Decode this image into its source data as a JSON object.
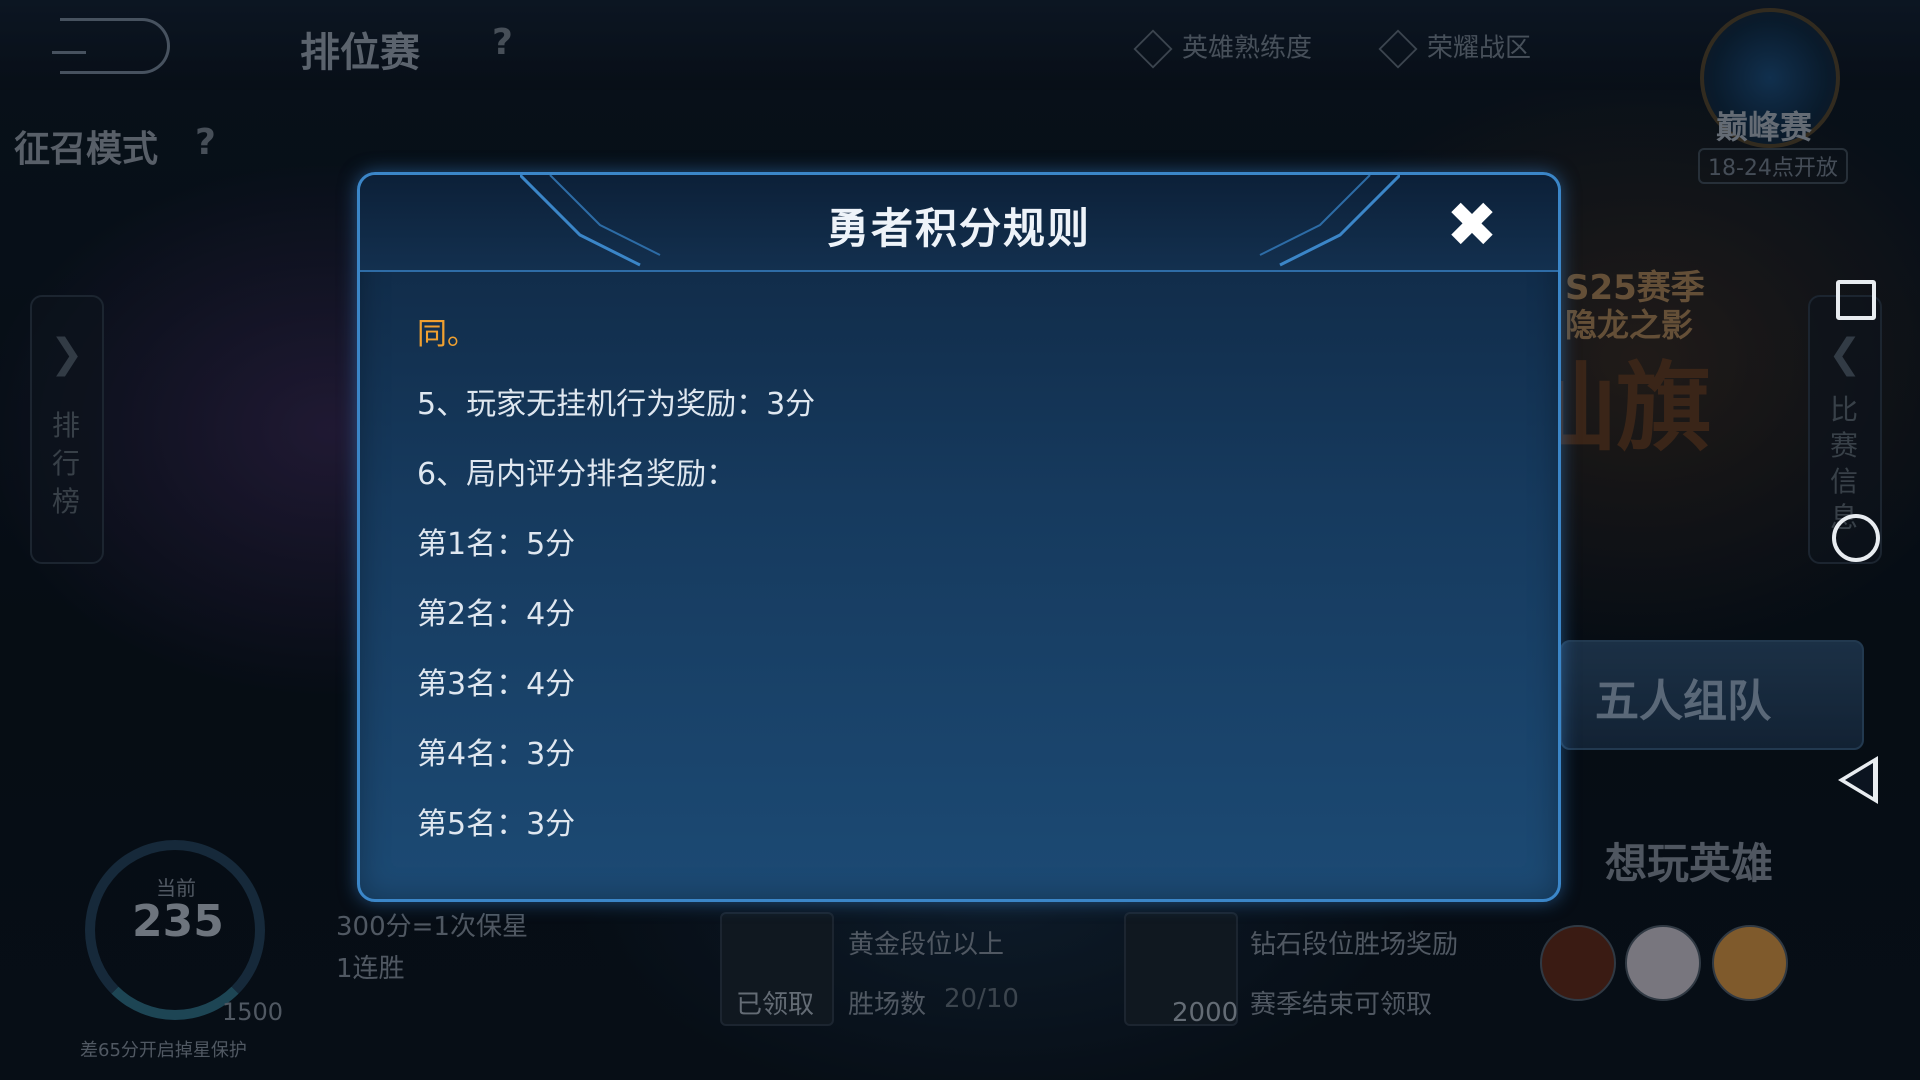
{
  "header": {
    "title": "排位赛",
    "help": "?",
    "links": [
      "英雄熟练度",
      "荣耀战区"
    ],
    "peak": {
      "label": "巅峰赛",
      "time": "18-24点开放"
    }
  },
  "mode": {
    "label": "征召模式",
    "help": "?"
  },
  "left_panel": {
    "label": "排行榜"
  },
  "right_panel": {
    "label": "比赛信息"
  },
  "season": {
    "tag": "S25赛季",
    "subtitle": "隐龙之影",
    "big": "仙旗"
  },
  "team_button": {
    "label": "五人组队"
  },
  "want_hero": {
    "label": "想玩英雄"
  },
  "score_gauge": {
    "caption": "当前",
    "value": "235",
    "max": "1500",
    "hint": "差65分开启掉星保护"
  },
  "bottom_info": {
    "rate": "300分=1次保星",
    "streak": "1连胜"
  },
  "rewards": [
    {
      "card_label": "已领取",
      "line1": "黄金段位以上",
      "line2": "胜场数",
      "progress": "20/10"
    },
    {
      "card_label": "2000",
      "line1": "钻石段位胜场奖励",
      "line2": "赛季结束可领取"
    }
  ],
  "modal": {
    "title": "勇者积分规则",
    "close_icon": "close-icon",
    "rules": [
      {
        "text": "同。",
        "highlight": true
      },
      {
        "text": "5、玩家无挂机行为奖励：3分"
      },
      {
        "text": "6、局内评分排名奖励："
      },
      {
        "text": "第1名：5分"
      },
      {
        "text": "第2名：4分"
      },
      {
        "text": "第3名：4分"
      },
      {
        "text": "第4名：3分"
      },
      {
        "text": "第5名：3分"
      }
    ]
  },
  "colors": {
    "modal_border": "#3b86c8",
    "highlight": "#f0a030",
    "text": "#dfe7f0"
  }
}
